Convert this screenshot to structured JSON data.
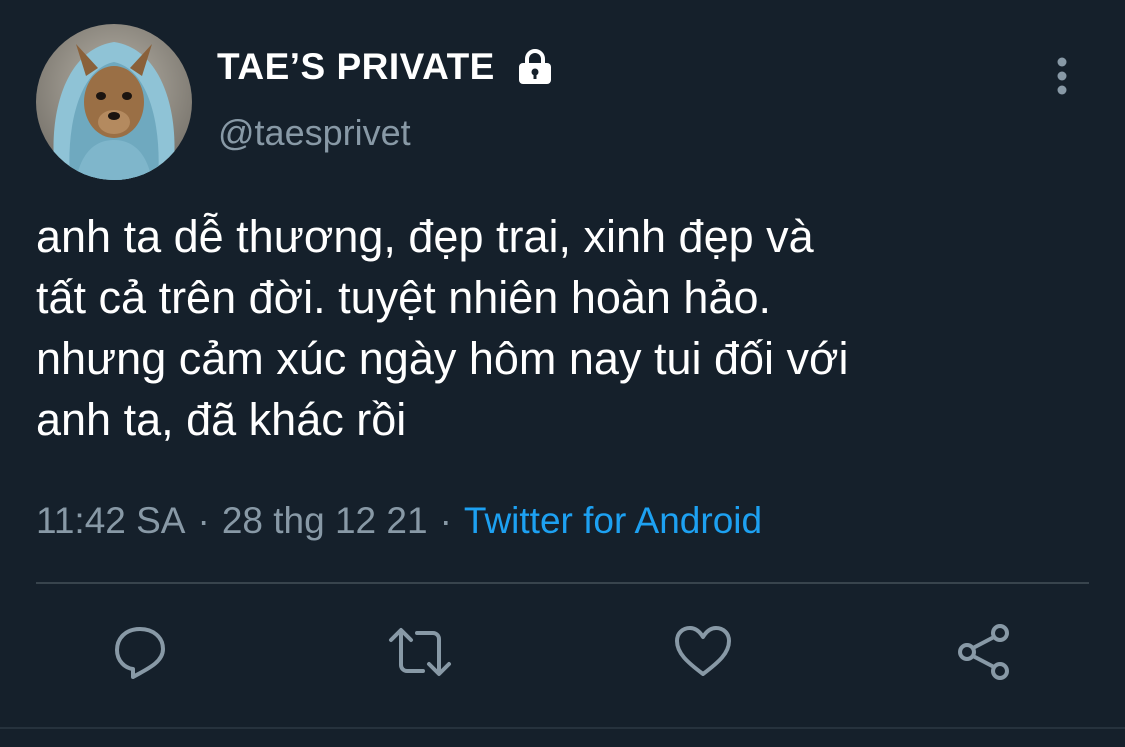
{
  "tweet": {
    "author": {
      "display_name": "TAE’S PRIVATE",
      "handle": "@taesprivet",
      "protected_icon": "lock-icon",
      "avatar": "dog-in-blue-hoodie-avatar"
    },
    "text_lines": [
      "anh ta dễ thương, đẹp trai, xinh đẹp và",
      "tất cả trên đời. tuyệt nhiên hoàn hảo.",
      "nhưng cảm xúc ngày hôm nay tui đối với",
      "anh ta, đã khác rồi"
    ],
    "time": "11:42 SA",
    "date": "28 thg 12 21",
    "separator": "·",
    "source": "Twitter for Android"
  },
  "actions": [
    {
      "name": "reply",
      "icon": "reply-icon"
    },
    {
      "name": "retweet",
      "icon": "retweet-icon"
    },
    {
      "name": "like",
      "icon": "heart-icon"
    },
    {
      "name": "share",
      "icon": "share-icon"
    }
  ],
  "more_menu_icon": "more-vertical-icon",
  "colors": {
    "background": "#15202b",
    "text_primary": "#ffffff",
    "text_secondary": "#8899a6",
    "accent": "#1da1f2",
    "divider": "#38444d"
  }
}
